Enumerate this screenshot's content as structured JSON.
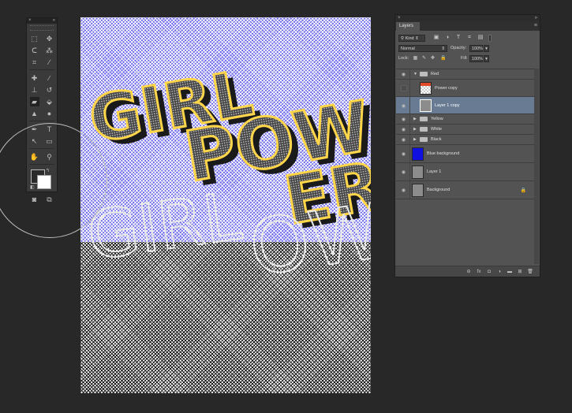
{
  "tools_panel": {
    "close_glyph": "×",
    "collapse_glyph": "»",
    "rows": [
      [
        "marquee-icon",
        "move-icon"
      ],
      [
        "lasso-icon",
        "magic-wand-icon"
      ],
      [
        "crop-icon",
        "eyedropper-icon"
      ],
      [
        "healing-brush-icon",
        "brush-icon"
      ],
      [
        "clone-stamp-icon",
        "history-brush-icon"
      ],
      [
        "eraser-icon",
        "paint-bucket-icon"
      ],
      [
        "blur-icon",
        "dodge-icon"
      ],
      [
        "pen-icon",
        "type-icon"
      ],
      [
        "path-selection-icon",
        "rectangle-icon"
      ],
      [
        "hand-icon",
        "zoom-icon"
      ]
    ],
    "glyphs": {
      "marquee-icon": "⬚",
      "move-icon": "✥",
      "lasso-icon": "ᑕ",
      "magic-wand-icon": "⁂",
      "crop-icon": "⌗",
      "eyedropper-icon": "⁄",
      "healing-brush-icon": "✚",
      "brush-icon": "∕",
      "clone-stamp-icon": "⊥",
      "history-brush-icon": "↺",
      "eraser-icon": "▰",
      "paint-bucket-icon": "⬙",
      "blur-icon": "▲",
      "dodge-icon": "●",
      "pen-icon": "✒",
      "type-icon": "T",
      "path-selection-icon": "↖",
      "rectangle-icon": "▭",
      "hand-icon": "✋",
      "zoom-icon": "⚲"
    },
    "active_tool": "eraser-icon",
    "foreground_color": "#2b2b2b",
    "background_color": "#ffffff",
    "swap_glyph": "↰",
    "reset_glyph": "◧",
    "quick_mask_glyph": "◙",
    "screen_mode_glyph": "⧉"
  },
  "canvas": {
    "background_color": "#6a66ee",
    "text_fill_color": "#ffd54a",
    "words": {
      "girl_top": "GIRL",
      "pow": "POW",
      "er": "ER",
      "girl_bottom": "GIRL",
      "ow": "OW"
    }
  },
  "layers_panel": {
    "close_glyph": "×",
    "collapse_glyph": "»",
    "tab_label": "Layers",
    "menu_glyph": "≡",
    "filter_kind": "Kind",
    "filter_icons": [
      "image-filter-icon",
      "adjustment-filter-icon",
      "type-filter-icon",
      "shape-filter-icon",
      "smart-object-filter-icon"
    ],
    "filter_glyphs": [
      "▣",
      "◑",
      "T",
      "⌗",
      "▤"
    ],
    "blend_mode": "Normal",
    "opacity_label": "Opacity:",
    "opacity_value": "100%",
    "lock_label": "Lock:",
    "lock_glyphs": [
      "▦",
      "✎",
      "✥",
      "🔒"
    ],
    "fill_label": "Fill:",
    "fill_value": "100%",
    "eye_glyph": "◉",
    "layers": [
      {
        "name": "Red",
        "kind": "group",
        "expanded": true,
        "visible": true,
        "indent": 0
      },
      {
        "name": "Power copy",
        "kind": "layer",
        "visible": false,
        "indent": 1,
        "thumb": "red-art"
      },
      {
        "name": "Layer 1 copy",
        "kind": "layer",
        "visible": true,
        "indent": 1,
        "thumb": "gray",
        "selected": true
      },
      {
        "name": "Yellow",
        "kind": "group",
        "expanded": false,
        "visible": true,
        "indent": 0
      },
      {
        "name": "White",
        "kind": "group",
        "expanded": false,
        "visible": true,
        "indent": 0
      },
      {
        "name": "Black",
        "kind": "group",
        "expanded": false,
        "visible": true,
        "indent": 0
      },
      {
        "name": "Blue background",
        "kind": "layer",
        "visible": true,
        "indent": 0,
        "thumb": "blue"
      },
      {
        "name": "Layer 1",
        "kind": "layer",
        "visible": true,
        "indent": 0,
        "thumb": "gray"
      },
      {
        "name": "Background",
        "kind": "layer",
        "visible": true,
        "indent": 0,
        "thumb": "gray",
        "locked": true
      }
    ],
    "footer_glyphs": [
      "⊖",
      "fx",
      "◘",
      "◑",
      "▬",
      "⊞",
      "🗑"
    ]
  }
}
